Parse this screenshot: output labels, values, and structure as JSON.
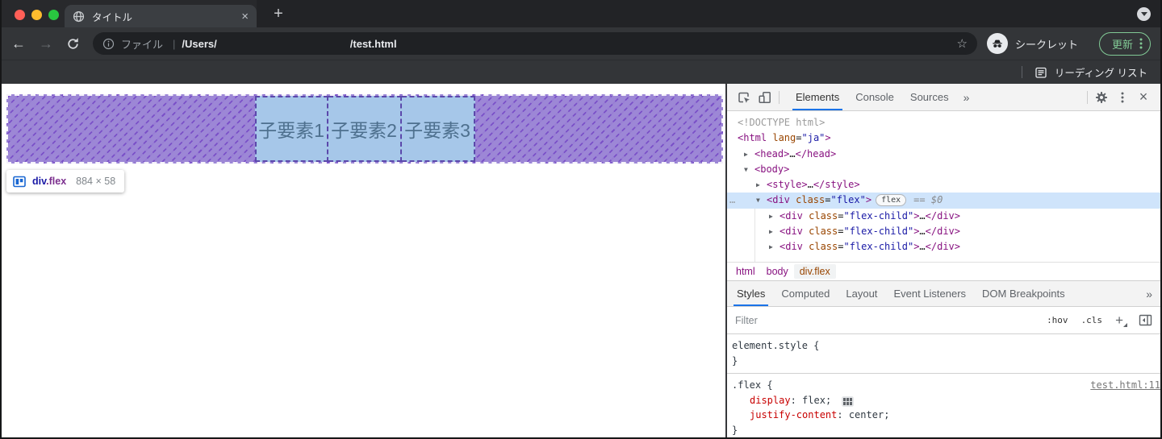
{
  "colors": {
    "accent": "#1a73e8",
    "update_green": "#81c995",
    "overlay_base": "#9d87d6",
    "overlay_line": "#7a50c8",
    "child_bg": "#a6c7e9",
    "child_border": "#5b48ab"
  },
  "browser": {
    "tab": {
      "title": "タイトル"
    },
    "new_tab_label": "+",
    "nav": {
      "back": "←",
      "forward": "→"
    },
    "omnibox": {
      "scheme": "ファイル",
      "separator": "|",
      "path_start": "/Users/",
      "path_end": "/test.html",
      "star": "☆"
    },
    "incognito_label": "シークレット",
    "update_button_label": "更新",
    "reading_list_label": "リーディング リスト",
    "tab_close": "×"
  },
  "page": {
    "flex_children": [
      "子要素1",
      "子要素2",
      "子要素3"
    ],
    "tooltip": {
      "tag": "div",
      "class": ".flex",
      "size": "884 × 58"
    }
  },
  "devtools": {
    "main_tabs": [
      {
        "label": "Elements",
        "active": true
      },
      {
        "label": "Console",
        "active": false
      },
      {
        "label": "Sources",
        "active": false
      }
    ],
    "more_tabs": "»",
    "close_label": "×",
    "dom_tree": {
      "rows": [
        {
          "indent": 1,
          "tokens": [
            {
              "t": "<!DOCTYPE html>",
              "c": "gray"
            }
          ]
        },
        {
          "indent": 1,
          "tokens": [
            {
              "t": "<html ",
              "c": "tag"
            },
            {
              "t": "lang",
              "c": "attr"
            },
            {
              "t": "=",
              "c": "plain"
            },
            {
              "t": "\"ja\"",
              "c": "value"
            },
            {
              "t": ">",
              "c": "tag"
            }
          ]
        },
        {
          "indent": 2,
          "arrow": "▶",
          "tokens": [
            {
              "t": "<head>",
              "c": "tag"
            },
            {
              "t": "…",
              "c": "plain"
            },
            {
              "t": "</head>",
              "c": "tag"
            }
          ]
        },
        {
          "indent": 2,
          "arrow": "▼",
          "tokens": [
            {
              "t": "<body>",
              "c": "tag"
            }
          ]
        },
        {
          "indent": 3,
          "arrow": "▶",
          "tokens": [
            {
              "t": "<style>",
              "c": "tag"
            },
            {
              "t": "…",
              "c": "plain"
            },
            {
              "t": "</style>",
              "c": "tag"
            }
          ]
        },
        {
          "indent": 3,
          "arrow": "▼",
          "selected": true,
          "gutter": "…",
          "tokens": [
            {
              "t": "<div ",
              "c": "tag"
            },
            {
              "t": "class",
              "c": "attr"
            },
            {
              "t": "=",
              "c": "plain"
            },
            {
              "t": "\"flex\"",
              "c": "value"
            },
            {
              "t": ">",
              "c": "tag"
            }
          ],
          "badge": "flex",
          "annotation": "== $0"
        },
        {
          "indent": 4,
          "arrow": "▶",
          "tokens": [
            {
              "t": "<div ",
              "c": "tag"
            },
            {
              "t": "class",
              "c": "attr"
            },
            {
              "t": "=",
              "c": "plain"
            },
            {
              "t": "\"flex-child\"",
              "c": "value"
            },
            {
              "t": ">",
              "c": "tag"
            },
            {
              "t": "…",
              "c": "plain"
            },
            {
              "t": "</div>",
              "c": "tag"
            }
          ]
        },
        {
          "indent": 4,
          "arrow": "▶",
          "tokens": [
            {
              "t": "<div ",
              "c": "tag"
            },
            {
              "t": "class",
              "c": "attr"
            },
            {
              "t": "=",
              "c": "plain"
            },
            {
              "t": "\"flex-child\"",
              "c": "value"
            },
            {
              "t": ">",
              "c": "tag"
            },
            {
              "t": "…",
              "c": "plain"
            },
            {
              "t": "</div>",
              "c": "tag"
            }
          ]
        },
        {
          "indent": 4,
          "arrow": "▶",
          "tokens": [
            {
              "t": "<div ",
              "c": "tag"
            },
            {
              "t": "class",
              "c": "attr"
            },
            {
              "t": "=",
              "c": "plain"
            },
            {
              "t": "\"flex-child\"",
              "c": "value"
            },
            {
              "t": ">",
              "c": "tag"
            },
            {
              "t": "…",
              "c": "plain"
            },
            {
              "t": "</div>",
              "c": "tag"
            }
          ]
        }
      ]
    },
    "breadcrumb": [
      {
        "label": "html",
        "active": false
      },
      {
        "label": "body",
        "active": false
      },
      {
        "label": "div.flex",
        "active": true
      }
    ],
    "sidebar_tabs": [
      {
        "label": "Styles",
        "active": true
      },
      {
        "label": "Computed",
        "active": false
      },
      {
        "label": "Layout",
        "active": false
      },
      {
        "label": "Event Listeners",
        "active": false
      },
      {
        "label": "DOM Breakpoints",
        "active": false
      }
    ],
    "sidebar_more": "»",
    "styles_pane": {
      "filter_placeholder": "Filter",
      "toggles": [
        ":hov",
        ".cls"
      ],
      "add_rule_label": "+",
      "element_style": {
        "selector": "element.style",
        "open": " {",
        "close": "}"
      },
      "rule": {
        "selector": ".flex",
        "open": " {",
        "close": "}",
        "source": "test.html:11",
        "declarations": [
          {
            "name": "display",
            "value": "flex",
            "flex_icon": true
          },
          {
            "name": "justify-content",
            "value": "center",
            "flex_icon": false
          }
        ]
      }
    }
  }
}
